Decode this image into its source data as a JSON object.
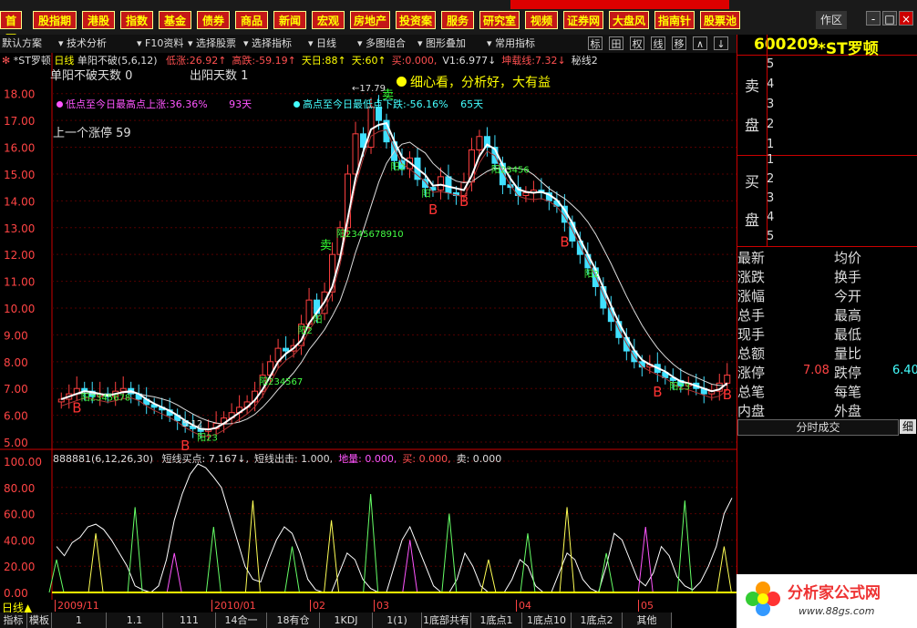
{
  "top_menu": {
    "first_tab": "首页",
    "tabs": [
      "股指期",
      "港股",
      "指数",
      "基金",
      "债券",
      "商品",
      "新闻",
      "宏观",
      "房地产",
      "投资案",
      "服务",
      "研究室",
      "视频",
      "证券网",
      "大盘风",
      "指南针",
      "股票池"
    ],
    "zone": "作区",
    "close": "×",
    "min": "-",
    "restore": "□"
  },
  "toolbar": {
    "items": [
      "默认方案",
      "技术分析",
      "F10资料",
      "选择股票",
      "选择指标",
      "日线",
      "多图组合",
      "图形叠加",
      "常用指标"
    ],
    "btns": [
      "标",
      "田",
      "权",
      "线",
      "移",
      "∧",
      "↓"
    ]
  },
  "stock": {
    "code": "600209",
    "name": "*ST罗顿"
  },
  "chart_header": {
    "name": "*ST罗顿",
    "period": "日线",
    "indicator": "单阳不破(5,6,12)",
    "items": [
      {
        "text": "低涨:26.92↑",
        "color": "#ff5050"
      },
      {
        "text": "高跌:-59.19↑",
        "color": "#ff5050"
      },
      {
        "text": "天日:88↑",
        "color": "#ffff00"
      },
      {
        "text": "天:60↑",
        "color": "#ffff00"
      },
      {
        "text": "买:0.000,",
        "color": "#ff5050"
      },
      {
        "text": "V1:6.977↓",
        "color": "#dddddd"
      },
      {
        "text": "坤载线:7.32↓",
        "color": "#ff5050"
      },
      {
        "text": "秘线2",
        "color": "#dddddd"
      }
    ]
  },
  "overlays": {
    "dan_yang": "单阳不破天数 0",
    "chu_yang": "出阳天数 1",
    "xin": "细心看，分析好，大有益",
    "low_to_high": "低点至今日最高点上涨:36.36%",
    "low_days": "93天",
    "high_to_low": "高点至今日最低点下跌:-56.16%",
    "high_days": "65天",
    "last_limit": "上一个涨停 59",
    "peak": "17.79",
    "trough": "5.12"
  },
  "chart_data": {
    "type": "candlestick",
    "title": "*ST罗顿 日线",
    "y_ticks": [
      "18.00",
      "17.00",
      "16.00",
      "15.00",
      "14.00",
      "13.00",
      "12.00",
      "11.00",
      "10.00",
      "9.00",
      "8.00",
      "7.00",
      "6.00",
      "5.00"
    ],
    "ylim": [
      4.9,
      18.5
    ],
    "closes": [
      6.6,
      6.8,
      7.0,
      6.9,
      6.7,
      6.8,
      6.7,
      6.9,
      7.0,
      6.8,
      6.6,
      6.4,
      6.3,
      6.2,
      6.0,
      5.8,
      5.6,
      5.5,
      5.4,
      5.5,
      5.7,
      5.9,
      6.1,
      6.3,
      6.5,
      6.9,
      7.5,
      8.0,
      8.5,
      8.4,
      8.6,
      9.4,
      10.3,
      9.8,
      10.6,
      12.0,
      13.0,
      15.0,
      16.5,
      16.0,
      17.5,
      17.0,
      16.2,
      15.5,
      15.2,
      15.6,
      14.8,
      14.5,
      14.4,
      14.9,
      14.3,
      14.2,
      14.7,
      15.9,
      16.4,
      16.0,
      15.4,
      14.6,
      14.5,
      14.2,
      14.3,
      14.4,
      14.3,
      14.0,
      13.8,
      13.2,
      12.5,
      12.0,
      11.5,
      10.8,
      10.0,
      9.5,
      8.9,
      8.4,
      8.0,
      7.8,
      7.9,
      7.6,
      7.4,
      7.3,
      7.1,
      7.2,
      7.0,
      6.8,
      6.9,
      7.2,
      7.5
    ],
    "markers": [
      {
        "label": "B",
        "i": 2
      },
      {
        "label": "B",
        "i": 16
      },
      {
        "label": "卖",
        "i": 34
      },
      {
        "label": "卖",
        "i": 42
      },
      {
        "label": "B",
        "i": 48
      },
      {
        "label": "B",
        "i": 52
      },
      {
        "label": "B",
        "i": 65
      },
      {
        "label": "B",
        "i": 77
      },
      {
        "label": "B",
        "i": 86
      }
    ],
    "yang_labels": [
      "阳2345678",
      "阳23",
      "阳234567",
      "阳2",
      "阳",
      "阳2345678910",
      "阳2",
      "阳",
      "阳23456",
      "阳2",
      "阳23"
    ],
    "osc_header": {
      "id": "888881(6,12,26,30)",
      "items": [
        {
          "text": "短线买点: 7.167↓,",
          "color": "#dddddd"
        },
        {
          "text": "短线出击: 1.000,",
          "color": "#dddddd"
        },
        {
          "text": "地量: 0.000,",
          "color": "#ff55ff"
        },
        {
          "text": "买: 0.000,",
          "color": "#ff5050"
        },
        {
          "text": "卖: 0.000",
          "color": "#dddddd"
        }
      ]
    },
    "osc_y_ticks": [
      "100.00",
      "80.00",
      "60.00",
      "40.00",
      "20.00",
      "0.00"
    ],
    "osc_line": [
      35,
      28,
      38,
      42,
      50,
      52,
      48,
      40,
      30,
      20,
      5,
      2,
      0,
      5,
      25,
      55,
      75,
      90,
      98,
      95,
      88,
      80,
      60,
      40,
      20,
      10,
      8,
      25,
      40,
      50,
      45,
      30,
      10,
      2,
      0,
      0,
      15,
      30,
      25,
      10,
      3,
      0,
      0,
      20,
      40,
      50,
      35,
      20,
      5,
      0,
      0,
      10,
      30,
      20,
      5,
      0,
      0,
      0,
      10,
      25,
      20,
      5,
      0,
      0,
      15,
      30,
      25,
      10,
      3,
      0,
      20,
      45,
      40,
      25,
      10,
      5,
      15,
      35,
      28,
      12,
      5,
      2,
      8,
      20,
      35,
      60,
      72
    ],
    "osc_time_labels": [
      "2009/11",
      "2010/01",
      "02",
      "03",
      "04",
      "05"
    ]
  },
  "period_label": "日线",
  "right_panel": {
    "sell_label": [
      "卖",
      "盘"
    ],
    "sell_levels": [
      "5",
      "4",
      "3",
      "2",
      "1"
    ],
    "buy_label": [
      "买",
      "盘"
    ],
    "buy_levels": [
      "1",
      "2",
      "3",
      "4",
      "5"
    ],
    "rows": [
      {
        "l": "最新",
        "r": "均价",
        "lv": "",
        "rv": ""
      },
      {
        "l": "涨跌",
        "r": "换手",
        "lv": "",
        "rv": ""
      },
      {
        "l": "涨幅",
        "r": "今开",
        "lv": "",
        "rv": ""
      },
      {
        "l": "总手",
        "r": "最高",
        "lv": "",
        "rv": ""
      },
      {
        "l": "现手",
        "r": "最低",
        "lv": "",
        "rv": ""
      },
      {
        "l": "总额",
        "r": "量比",
        "lv": "",
        "rv": ""
      },
      {
        "l": "涨停",
        "r": "跌停",
        "lv": "7.08",
        "rv": "6.40"
      },
      {
        "l": "总笔",
        "r": "每笔",
        "lv": "",
        "rv": ""
      },
      {
        "l": "内盘",
        "r": "外盘",
        "lv": "",
        "rv": ""
      }
    ],
    "tick_tab": "分时成交",
    "detail_tab": "细"
  },
  "bottom_tabs": [
    "指标",
    "模板",
    "1",
    "1.1",
    "111",
    "14合一",
    "18有仓",
    "1KDJ",
    "1(1)",
    "1底部共有",
    "1底点1",
    "1底点10",
    "1底点2",
    "其他"
  ],
  "logo": {
    "text": "分析家公式网",
    "url": "www.88gs.com"
  }
}
